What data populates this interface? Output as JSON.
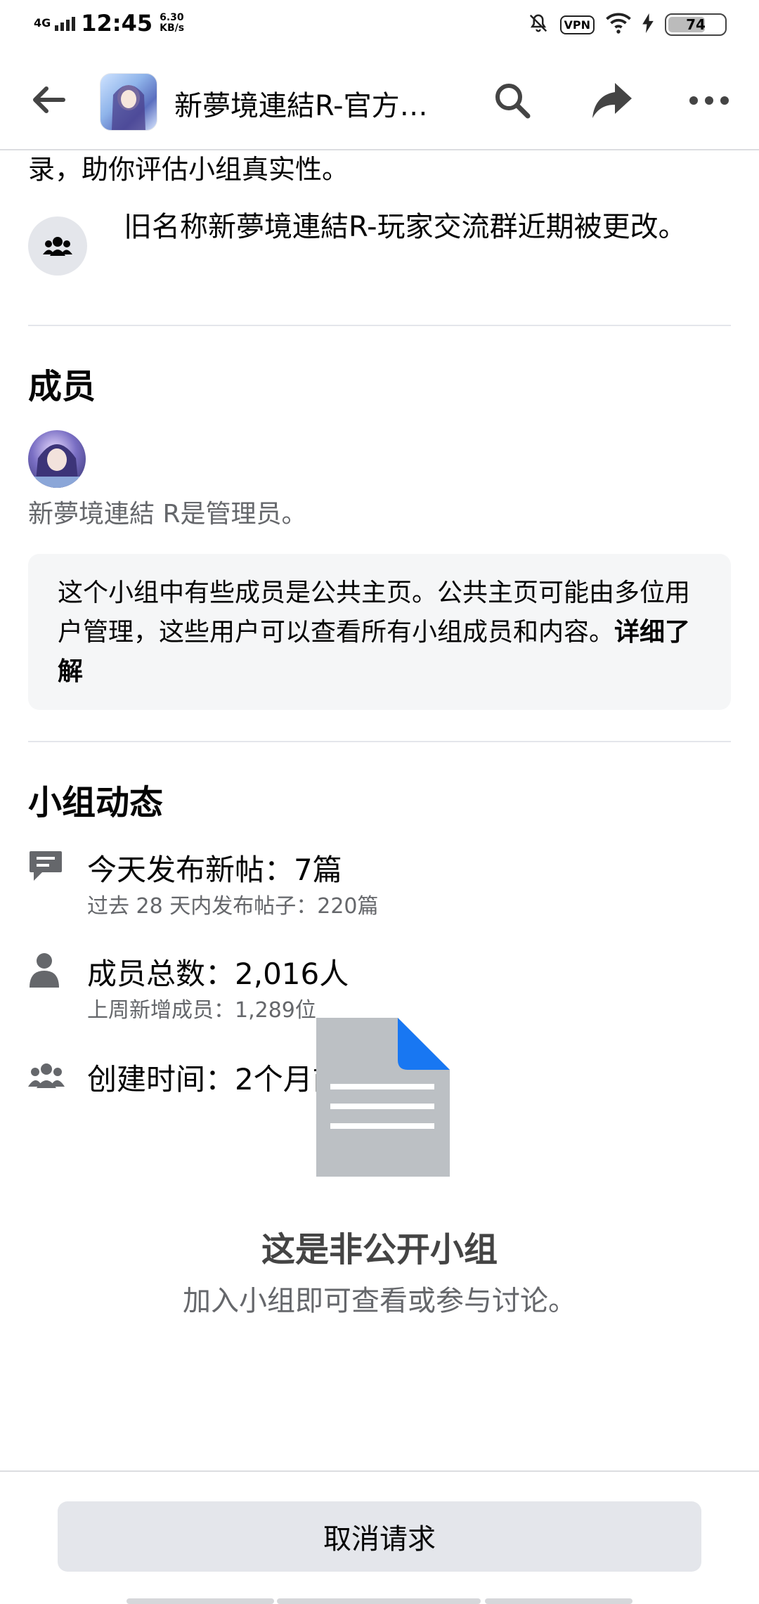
{
  "status_bar": {
    "network": "4G",
    "time": "12:45",
    "speed_value": "6.30",
    "speed_unit": "KB/s",
    "vpn": "VPN",
    "battery": "74"
  },
  "header": {
    "title": "新夢境連結R-官方…"
  },
  "about": {
    "cut_text": "录，助你评估小组真实性。",
    "old_name_text": "旧名称新夢境連結R-玩家交流群近期被更改。"
  },
  "members": {
    "title": "成员",
    "admin_text": "新夢境連結 R是管理员。",
    "notice_text": "这个小组中有些成员是公共主页。公共主页可能由多位用户管理，这些用户可以查看所有小组成员和内容。",
    "notice_link": "详细了解"
  },
  "activity": {
    "title": "小组动态",
    "posts_today": "今天发布新帖：7篇",
    "posts_28d": "过去 28 天内发布帖子：220篇",
    "members_total": "成员总数：2,016人",
    "members_new": "上周新增成员：1,289位",
    "created": "创建时间：2个月前"
  },
  "private": {
    "title": "这是非公开小组",
    "subtitle": "加入小组即可查看或参与讨论。"
  },
  "bottom": {
    "cancel_label": "取消请求"
  },
  "icons": {
    "back": "arrow-left-icon",
    "search": "search-icon",
    "share": "share-icon",
    "more": "more-icon",
    "group": "group-icon",
    "posts": "chat-bubble-icon",
    "member": "person-icon",
    "created": "group-icon",
    "doc": "document-icon"
  },
  "colors": {
    "primary_text": "#050505",
    "secondary_text": "#65676b",
    "button_bg": "#e4e6eb",
    "doc_corner": "#1877f2",
    "doc_body": "#bcc0c4"
  }
}
